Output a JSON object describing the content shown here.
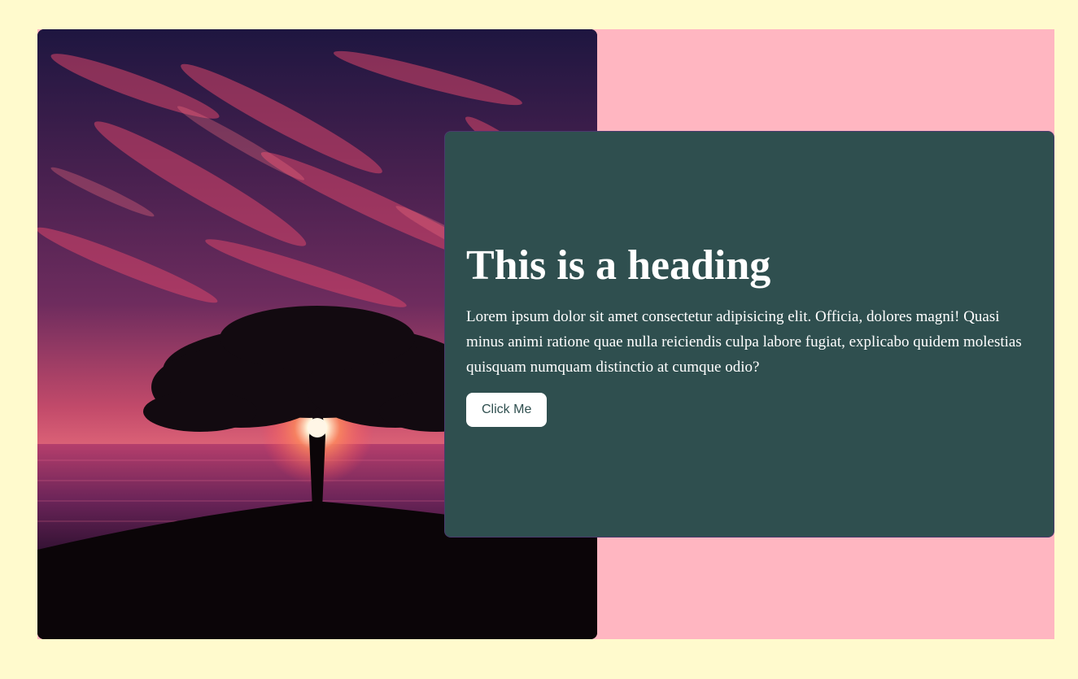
{
  "hero": {
    "image_alt": "Silhouette of a tree against a sunset over the sea under a purple and red sky"
  },
  "panel": {
    "heading": "This is a heading",
    "body": "Lorem ipsum dolor sit amet consectetur adipisicing elit. Officia, dolores magni! Quasi minus animi ratione quae nulla reiciendis culpa labore fugiat, explicabo quidem molestias quisquam numquam distinctio at cumque odio?",
    "button_label": "Click Me"
  },
  "colors": {
    "page_background": "#fffacd",
    "card_background": "#ffb6c1",
    "panel_background": "#2f4f4f",
    "text": "#ffffff",
    "button_background": "#ffffff",
    "button_text": "#2f4f4f"
  }
}
